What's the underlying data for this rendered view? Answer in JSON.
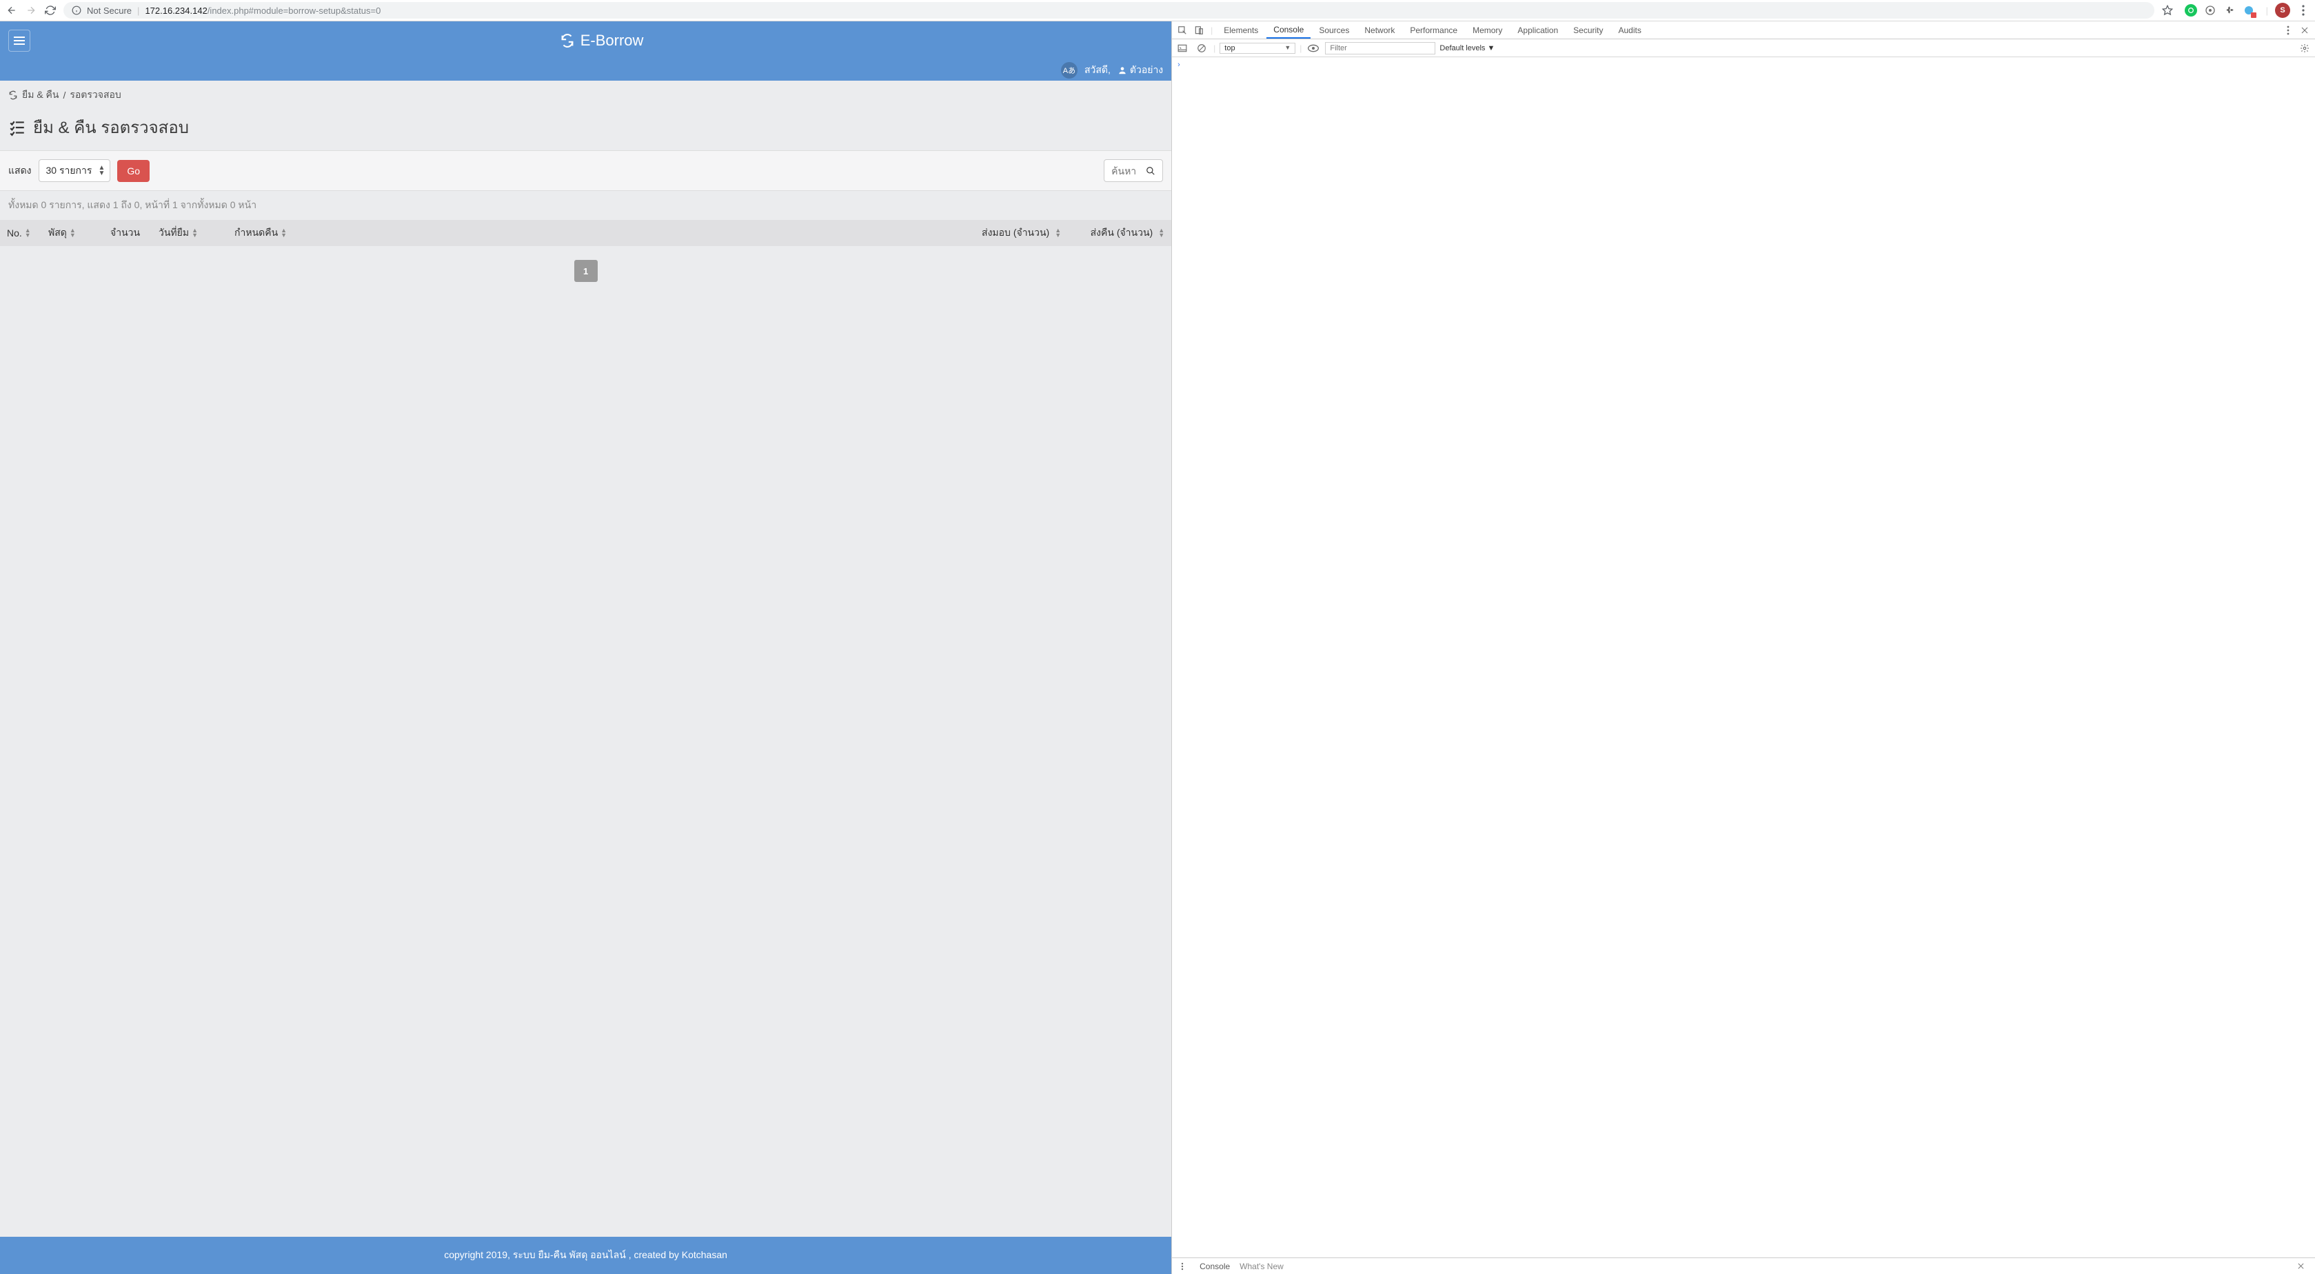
{
  "browser": {
    "not_secure": "Not Secure",
    "url_host": "172.16.234.142",
    "url_path": "/index.php#module=borrow-setup&status=0",
    "avatar_letter": "S"
  },
  "app": {
    "title": "E-Borrow",
    "greeting": "สวัสดี,",
    "username": "ตัวอย่าง",
    "lang_badge": "Aあ",
    "breadcrumb": {
      "root": "ยืม & คืน",
      "sep": "/",
      "current": "รอตรวจสอบ"
    },
    "page_title": "ยืม & คืน รอตรวจสอบ",
    "show_label": "แสดง",
    "per_page": "30 รายการ",
    "go_button": "Go",
    "search_placeholder": "ค้นหา",
    "status_line": "ทั้งหมด 0 รายการ, แสดง 1 ถึง 0, หน้าที่ 1 จากทั้งหมด 0 หน้า",
    "columns": {
      "no": "No.",
      "asset": "พัสดุ",
      "qty": "จำนวน",
      "borrow_date": "วันที่ยืม",
      "due_date": "กำหนดคืน",
      "delivered": "ส่งมอบ (จำนวน)",
      "returned": "ส่งคืน (จำนวน)"
    },
    "page_number": "1",
    "footer": "copyright 2019, ระบบ ยืม-คืน พัสดุ ออนไลน์ , created by Kotchasan"
  },
  "devtools": {
    "tabs": [
      "Elements",
      "Console",
      "Sources",
      "Network",
      "Performance",
      "Memory",
      "Application",
      "Security",
      "Audits"
    ],
    "active_tab": "Console",
    "context": "top",
    "filter_placeholder": "Filter",
    "levels": "Default levels ▼",
    "prompt": "›",
    "drawer": {
      "console": "Console",
      "whats_new": "What's New"
    }
  }
}
